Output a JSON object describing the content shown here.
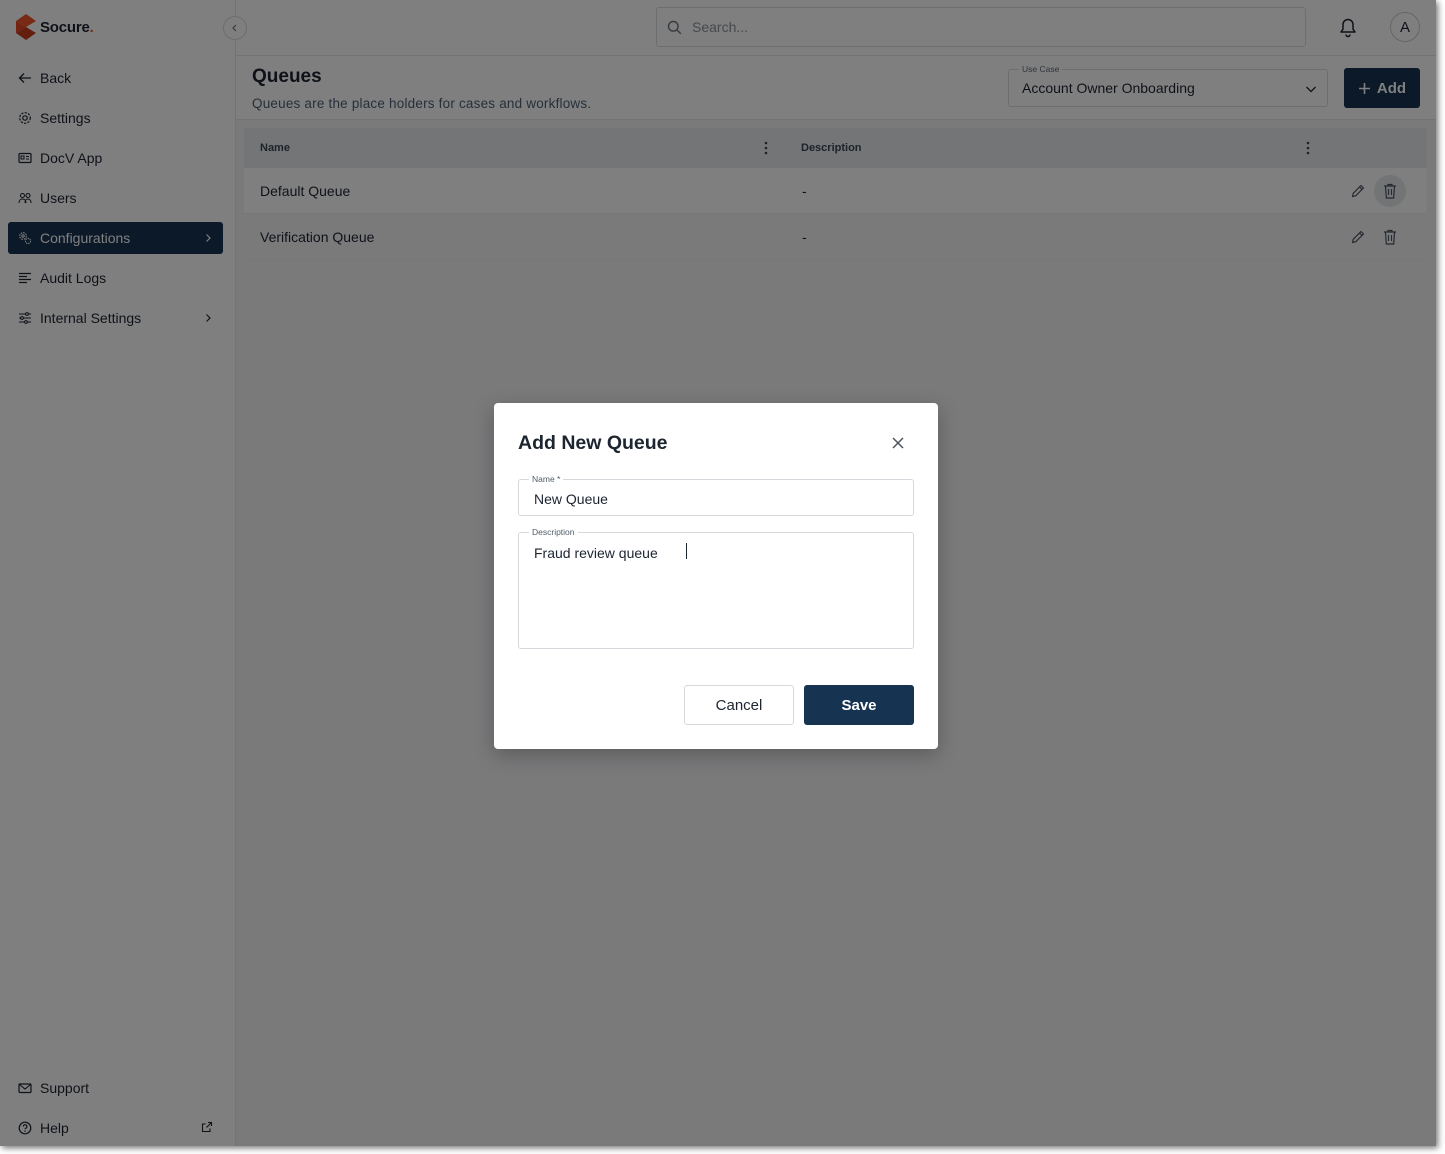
{
  "brand": {
    "name": "Socure",
    "dot": "."
  },
  "sidebar": {
    "items": [
      {
        "label": "Back",
        "icon": "arrow-left-icon"
      },
      {
        "label": "Settings",
        "icon": "gear-icon"
      },
      {
        "label": "DocV App",
        "icon": "id-card-icon"
      },
      {
        "label": "Users",
        "icon": "users-icon"
      },
      {
        "label": "Configurations",
        "icon": "gears-icon",
        "active": true
      },
      {
        "label": "Audit Logs",
        "icon": "list-lines-icon"
      },
      {
        "label": "Internal Settings",
        "icon": "sliders-icon"
      }
    ],
    "bottom": [
      {
        "label": "Support",
        "icon": "mail-icon"
      },
      {
        "label": "Help",
        "icon": "help-circle-icon"
      }
    ]
  },
  "topbar": {
    "search_placeholder": "Search...",
    "avatar_initial": "A"
  },
  "page": {
    "title": "Queues",
    "subtitle": "Queues are the place holders for cases and workflows.",
    "use_case_label": "Use Case",
    "use_case_value": "Account Owner Onboarding",
    "add_label": "Add"
  },
  "table": {
    "columns": [
      "Name",
      "Description"
    ],
    "rows": [
      {
        "name": "Default Queue",
        "description": "-"
      },
      {
        "name": "Verification Queue",
        "description": "-"
      }
    ]
  },
  "modal": {
    "title": "Add New Queue",
    "name_label": "Name *",
    "name_value": "New Queue",
    "description_label": "Description",
    "description_value": "Fraud review queue",
    "cancel_label": "Cancel",
    "save_label": "Save"
  },
  "colors": {
    "primary": "#163352",
    "brand_orange": "#f0552b",
    "overlay": "rgba(0,0,0,0.5)"
  }
}
